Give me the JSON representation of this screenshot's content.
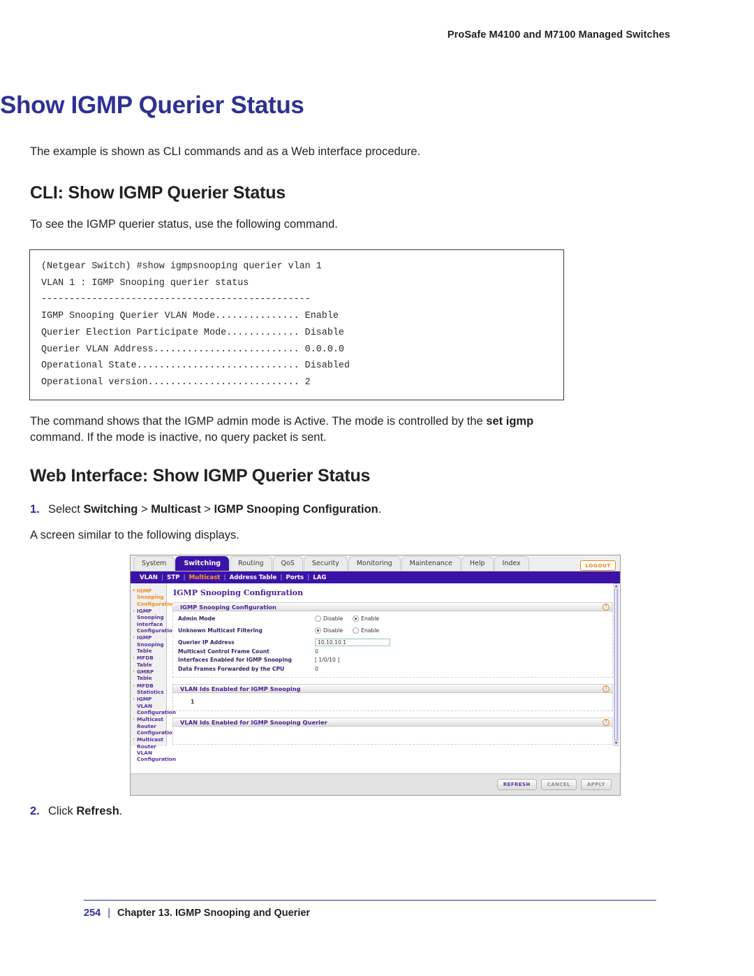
{
  "running_header": "ProSafe M4100 and M7100 Managed Switches",
  "doc": {
    "title": "Show IGMP Querier Status",
    "intro": "The example is shown as CLI commands and as a Web interface procedure.",
    "cli_section_title": "CLI: Show IGMP Querier Status",
    "cli_lead": "To see the IGMP querier status, use the following command.",
    "cli_output": "(Netgear Switch) #show igmpsnooping querier vlan 1\nVLAN 1 : IGMP Snooping querier status\n------------------------------------------------\nIGMP Snooping Querier VLAN Mode............... Enable\nQuerier Election Participate Mode............. Disable\nQuerier VLAN Address.......................... 0.0.0.0\nOperational State............................. Disabled\nOperational version........................... 2",
    "after_code_line1_a": "The command shows that the IGMP admin mode is Active. The mode is controlled by the ",
    "after_code_bold1": "set",
    "after_code_bold2": "igmp",
    "after_code_line2_b": " command. If the mode is inactive, no query packet is sent.",
    "web_section_title": "Web Interface: Show IGMP Querier Status",
    "step1_num": "1.",
    "step1_a": "Select ",
    "step1_b1": "Switching",
    "step1_sep1": " > ",
    "step1_b2": "Multicast",
    "step1_sep2": " > ",
    "step1_b3": "IGMP Snooping Configuration",
    "step1_end": ".",
    "screen_note": "A screen similar to the following displays.",
    "step2_num": "2.",
    "step2_a": "Click ",
    "step2_b": "Refresh",
    "step2_end": "."
  },
  "screenshot": {
    "tabs": [
      {
        "label": "System",
        "active": false
      },
      {
        "label": "Switching",
        "active": true
      },
      {
        "label": "Routing",
        "active": false
      },
      {
        "label": "QoS",
        "active": false
      },
      {
        "label": "Security",
        "active": false
      },
      {
        "label": "Monitoring",
        "active": false
      },
      {
        "label": "Maintenance",
        "active": false
      },
      {
        "label": "Help",
        "active": false
      },
      {
        "label": "Index",
        "active": false
      }
    ],
    "logout_label": "LOGOUT",
    "subnav": [
      {
        "label": "VLAN",
        "active": false
      },
      {
        "label": "STP",
        "active": false
      },
      {
        "label": "Multicast",
        "active": true
      },
      {
        "label": "Address Table",
        "active": false
      },
      {
        "label": "Ports",
        "active": false
      },
      {
        "label": "LAG",
        "active": false
      }
    ],
    "sidebar": [
      {
        "label": "IGMP Snooping Configuration",
        "active": true
      },
      {
        "label": "IGMP Snooping Interface Configuration",
        "active": false
      },
      {
        "label": "IGMP Snooping Table",
        "active": false
      },
      {
        "label": "MFDB Table",
        "active": false
      },
      {
        "label": "GMRP Table",
        "active": false
      },
      {
        "label": "MFDB Statistics",
        "active": false
      },
      {
        "label": "IGMP VLAN Configuration",
        "active": false
      },
      {
        "label": "Multicast Router Configuration",
        "active": false
      },
      {
        "label": "Multicast Router VLAN Configuration",
        "active": false
      }
    ],
    "page_heading": "IGMP Snooping Configuration",
    "panel1": {
      "title": "IGMP Snooping Configuration",
      "help": "?",
      "rows": [
        {
          "label": "Admin Mode",
          "type": "radio",
          "options": [
            {
              "label": "Disable",
              "selected": false
            },
            {
              "label": "Enable",
              "selected": true
            }
          ]
        },
        {
          "label": "Unknown Multicast Filtering",
          "type": "radio",
          "options": [
            {
              "label": "Disable",
              "selected": true
            },
            {
              "label": "Enable",
              "selected": false
            }
          ]
        },
        {
          "label": "Querier IP Address",
          "type": "input",
          "value": "10.10.10.1"
        },
        {
          "label": "Multicast Control Frame Count",
          "type": "text",
          "value": "0"
        },
        {
          "label": "Interfaces Enabled for IGMP Snooping",
          "type": "text",
          "value": "[ 1/0/10 ]"
        },
        {
          "label": "Data Frames Forwarded by the CPU",
          "type": "text",
          "value": "0"
        }
      ]
    },
    "panel2": {
      "title": "VLAN Ids Enabled for IGMP Snooping",
      "help": "?",
      "value": "1"
    },
    "panel3": {
      "title": "VLAN Ids Enabled for IGMP Snooping Querier",
      "help": "?",
      "value": ""
    },
    "buttons": [
      {
        "label": "REFRESH",
        "primary": true
      },
      {
        "label": "CANCEL",
        "primary": false
      },
      {
        "label": "APPLY",
        "primary": false
      }
    ],
    "colors": {
      "nav_purple": "#3b13a8",
      "accent_orange": "#e8871a",
      "panel_title_purple": "#4b1f91"
    }
  },
  "footer": {
    "page_number": "254",
    "separator": "|",
    "chapter": "Chapter 13. IGMP Snooping and Querier"
  },
  "title_color": "#2e3192"
}
